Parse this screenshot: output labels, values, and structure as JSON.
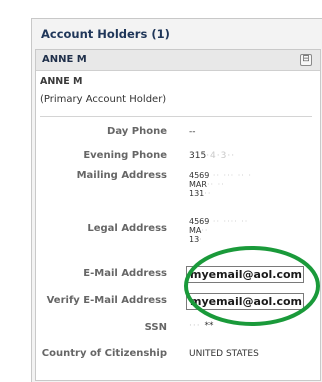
{
  "section_title": "Account Holders (1)",
  "holder": {
    "header_name": "ANNE M",
    "collapse_icon": "⊟",
    "name": "ANNE M",
    "role": "(Primary Account Holder)"
  },
  "fields": {
    "day_phone": {
      "label": "Day Phone",
      "value": "--"
    },
    "evening_phone": {
      "label": "Evening Phone",
      "value": "315"
    },
    "mailing_address": {
      "label": "Mailing Address",
      "line1": "4569",
      "line2": "MAR",
      "line3": "131"
    },
    "legal_address": {
      "label": "Legal Address",
      "line1": "4569",
      "line2": "MA",
      "line3": "13"
    },
    "email": {
      "label": "E-Mail Address",
      "value": "myemail@aol.com"
    },
    "verify_email": {
      "label": "Verify E-Mail Address",
      "value": "myemail@aol.com"
    },
    "ssn": {
      "label": "SSN",
      "value": "**"
    },
    "citizenship": {
      "label": "Country of Citizenship",
      "value": "UNITED STATES"
    }
  },
  "colors": {
    "annotation": "#1a9a3a",
    "header_text": "#1f3659",
    "label_text": "#666666"
  }
}
